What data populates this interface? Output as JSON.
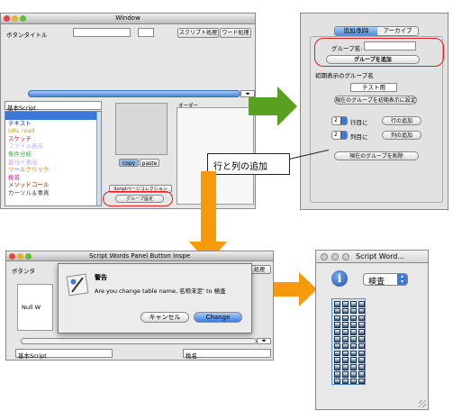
{
  "win1": {
    "title": "Window",
    "button_title_label": "ボタンタイトル",
    "script_btn": "スクリプト処理",
    "word_btn": "ワード処理",
    "list_header": "基本Script",
    "list_items": [
      {
        "text": "",
        "color": "#ffffff"
      },
      {
        "text": "テキスト",
        "color": "#1a1aa0"
      },
      {
        "text": "URL read",
        "color": "#b0b000"
      },
      {
        "text": "スケッチ",
        "color": "#e0102a"
      },
      {
        "text": "ファイル表示",
        "color": "#b0b0ff"
      },
      {
        "text": "条件分岐",
        "color": "#3aa53a"
      },
      {
        "text": "進行＋表示",
        "color": "#c0a0ff"
      },
      {
        "text": "ツールクリック",
        "color": "#f07000"
      },
      {
        "text": "桃名",
        "color": "#d02080"
      },
      {
        "text": "メソッドコール",
        "color": "#7a2a00"
      },
      {
        "text": "カーソル＆事真",
        "color": "#444444"
      }
    ],
    "copy_btn": "copy",
    "paste_btn": "paste",
    "order_label": "オーダー",
    "collection_btn": "Scriptページコレクション",
    "group_settings_btn": "グループ設定"
  },
  "panel": {
    "tab_add_delete": "追加/削除",
    "tab_archive": "アーカイブ",
    "group_name_label": "グループ名:",
    "add_group_btn": "グループを追加",
    "initial_group_label": "初期表示のグループ名",
    "initial_group_value": "テスト用",
    "set_initial_btn": "現在のグループを初期表示に設定",
    "row_stepper": "2",
    "row_unit": "行目に",
    "add_row_btn": "行の追加",
    "col_stepper": "2",
    "col_unit": "列目に",
    "add_col_btn": "列の追加",
    "delete_group_btn": "現在のグループを削除"
  },
  "callout": "行と列の追加",
  "win2": {
    "title": "Script Words Panel Button Inspe",
    "button_title_label": "ボタンタ",
    "word_btn": "処理",
    "null_label": "Null W",
    "list_header": "基本Script",
    "order_label": "桃名",
    "dialog": {
      "title": "警告",
      "message": "Are you change table name, 名称未定' to 検査",
      "cancel_btn": "キャンセル",
      "change_btn": "Change"
    }
  },
  "win3": {
    "title": "Script Word...",
    "select_value": "検査",
    "info_icon": "info-icon"
  },
  "colors": {
    "red_highlight": "#e02020",
    "green_arrow": "#5aa020",
    "orange_arrow": "#f59a0c",
    "mac_blue": "#3b78d8"
  }
}
